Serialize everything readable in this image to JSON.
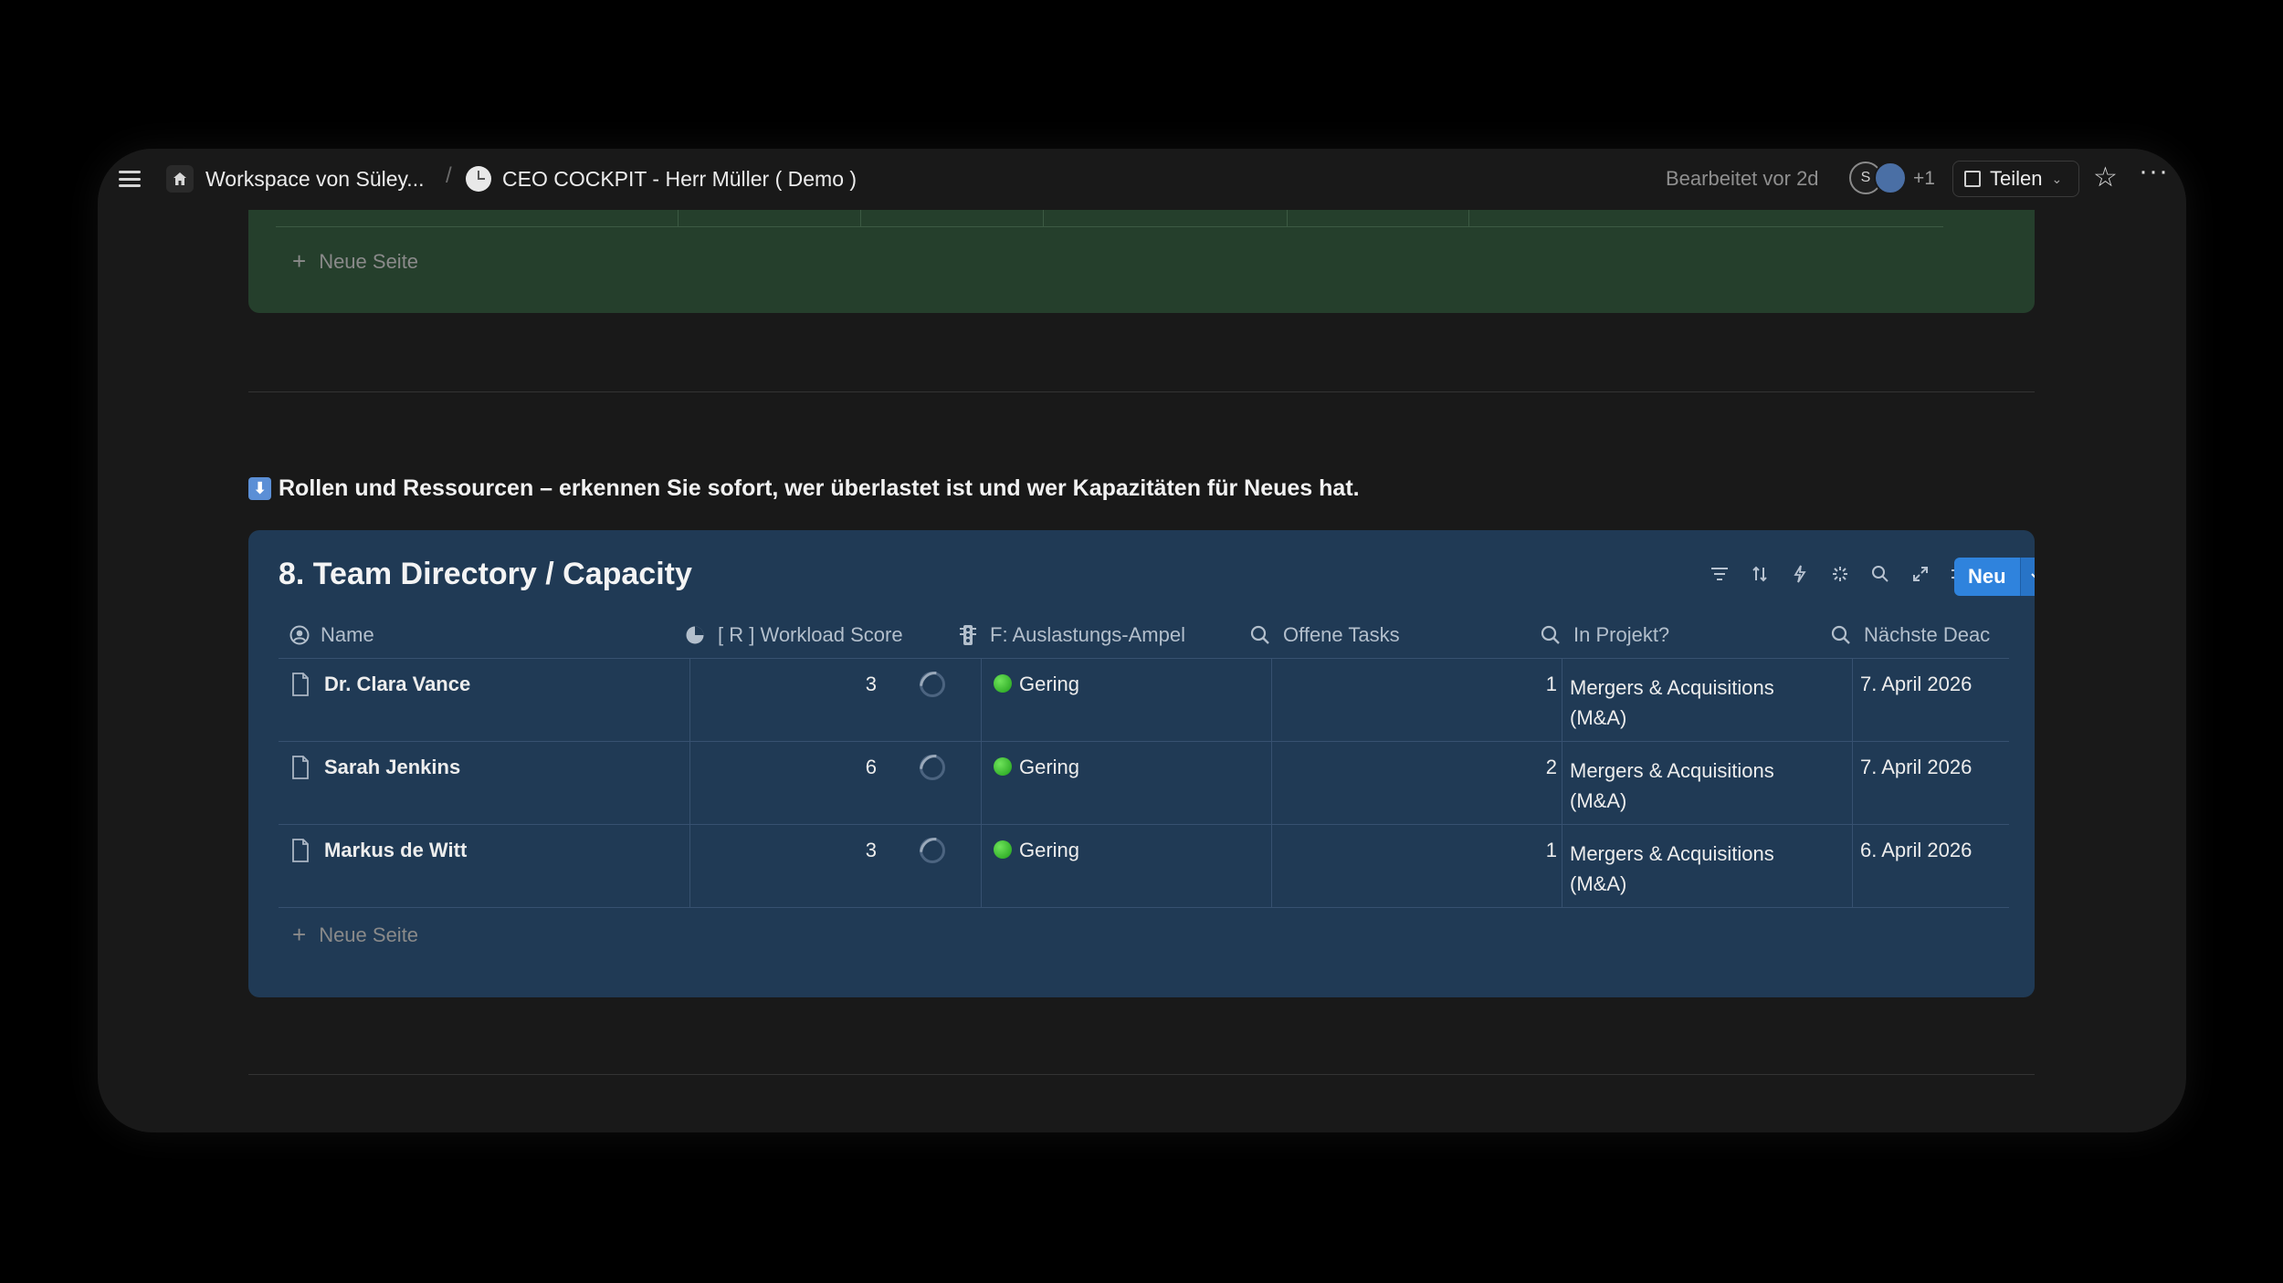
{
  "topbar": {
    "workspace": "Workspace von Süley...",
    "separator": "/",
    "page_title": "CEO COCKPIT - Herr Müller ( Demo )",
    "edited": "Bearbeitet vor 2d",
    "avatar_initial": "S",
    "extra_users": "+1",
    "share_label": "Teilen"
  },
  "green_section": {
    "new_page": "Neue Seite"
  },
  "section_heading": "Rollen und Ressourcen – erkennen Sie sofort, wer überlastet ist und wer Kapazitäten für Neues hat.",
  "database": {
    "title": "8. Team Directory / Capacity",
    "new_button": "Neu",
    "columns": [
      {
        "label": "Name"
      },
      {
        "label": "[ R ] Workload Score"
      },
      {
        "label": "F: Auslastungs-Ampel"
      },
      {
        "label": "Offene Tasks"
      },
      {
        "label": "In Projekt?"
      },
      {
        "label": "Nächste Deac"
      }
    ],
    "rows": [
      {
        "name": "Dr. Clara Vance",
        "workload": "3",
        "ampel": "Gering",
        "tasks": "1",
        "project_line1": "Mergers & Acquisitions",
        "project_line2": "(M&A)",
        "next": "7. April 2026"
      },
      {
        "name": "Sarah Jenkins",
        "workload": "6",
        "ampel": "Gering",
        "tasks": "2",
        "project_line1": "Mergers & Acquisitions",
        "project_line2": "(M&A)",
        "next": "7. April 2026"
      },
      {
        "name": "Markus de Witt",
        "workload": "3",
        "ampel": "Gering",
        "tasks": "1",
        "project_line1": "Mergers & Acquisitions",
        "project_line2": "(M&A)",
        "next": "6. April 2026"
      }
    ],
    "new_page": "Neue Seite"
  },
  "colors": {
    "background": "#000000",
    "window": "#191919",
    "green_block": "#253f2c",
    "db_block": "#203a55",
    "accent": "#2f83dd",
    "status_green": "#2fbf25"
  }
}
